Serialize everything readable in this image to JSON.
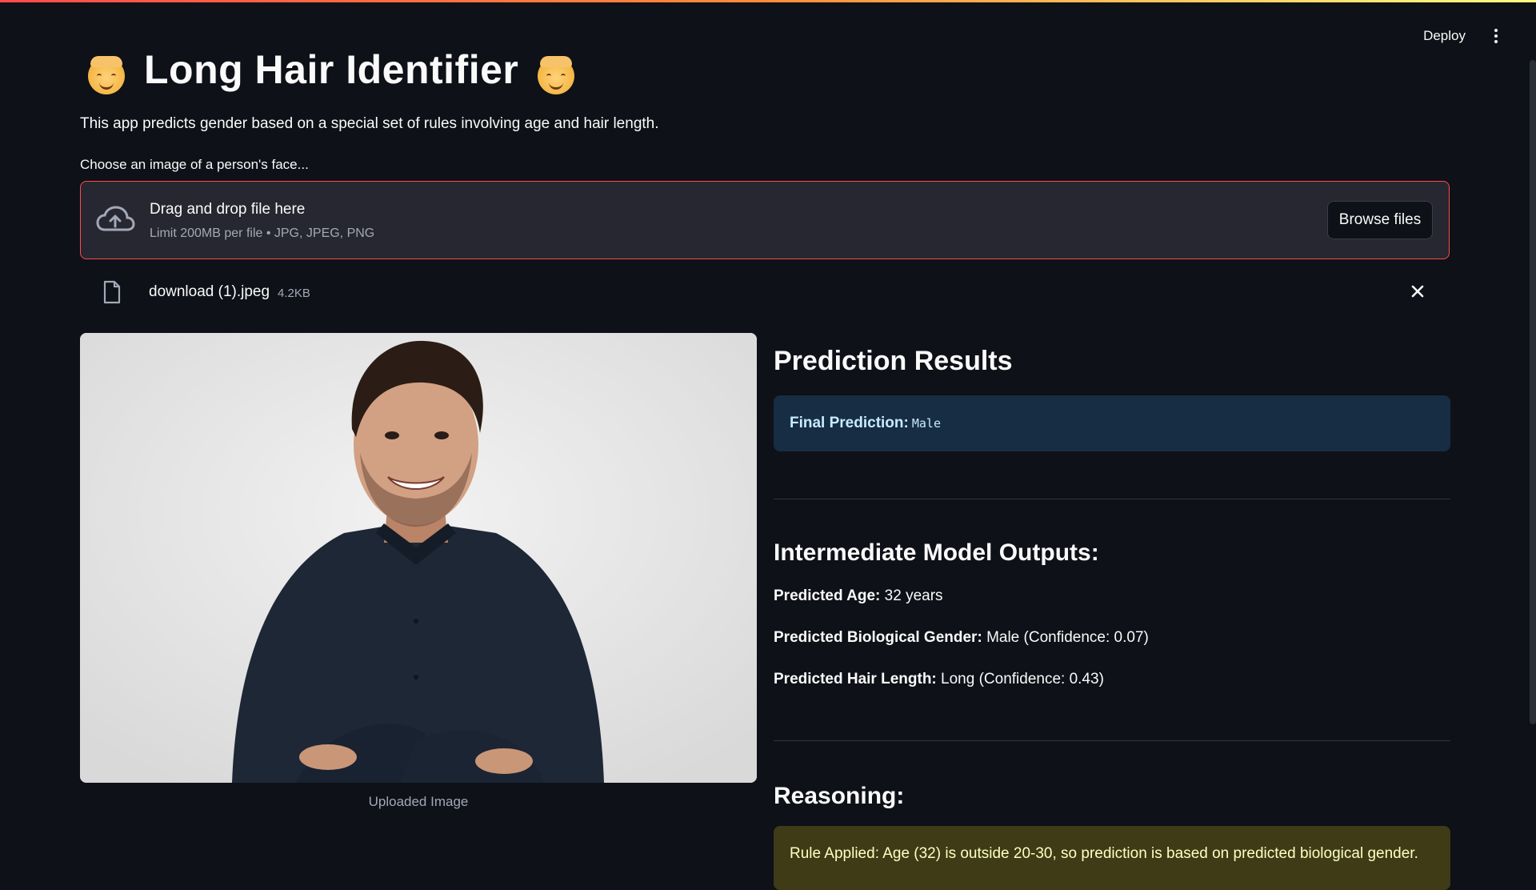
{
  "app": {
    "deploy_label": "Deploy",
    "menu_icon": "kebab-menu-icon"
  },
  "header": {
    "title": "Long Hair Identifier",
    "title_emoji": "smiling-face-with-halo-icon",
    "description": "This app predicts gender based on a special set of rules involving age and hair length."
  },
  "uploader": {
    "label": "Choose an image of a person's face...",
    "drop_title": "Drag and drop file here",
    "limit_text": "Limit 200MB per file • JPG, JPEG, PNG",
    "browse_label": "Browse files",
    "accent_color": "#ff4b4b"
  },
  "file": {
    "name": "download (1).jpeg",
    "size": "4.2KB"
  },
  "image": {
    "caption": "Uploaded Image"
  },
  "results": {
    "heading": "Prediction Results",
    "final_label": "Final Prediction:",
    "final_value": "Male",
    "intermediate_heading": "Intermediate Model Outputs:",
    "age_label": "Predicted Age:",
    "age_value": "32 years",
    "gender_label": "Predicted Biological Gender:",
    "gender_value": "Male (Confidence: 0.07)",
    "hair_label": "Predicted Hair Length:",
    "hair_value": "Long (Confidence: 0.43)",
    "reasoning_heading": "Reasoning:",
    "rule_text": "Rule Applied: Age (32) is outside 20-30, so prediction is based on predicted biological gender."
  }
}
